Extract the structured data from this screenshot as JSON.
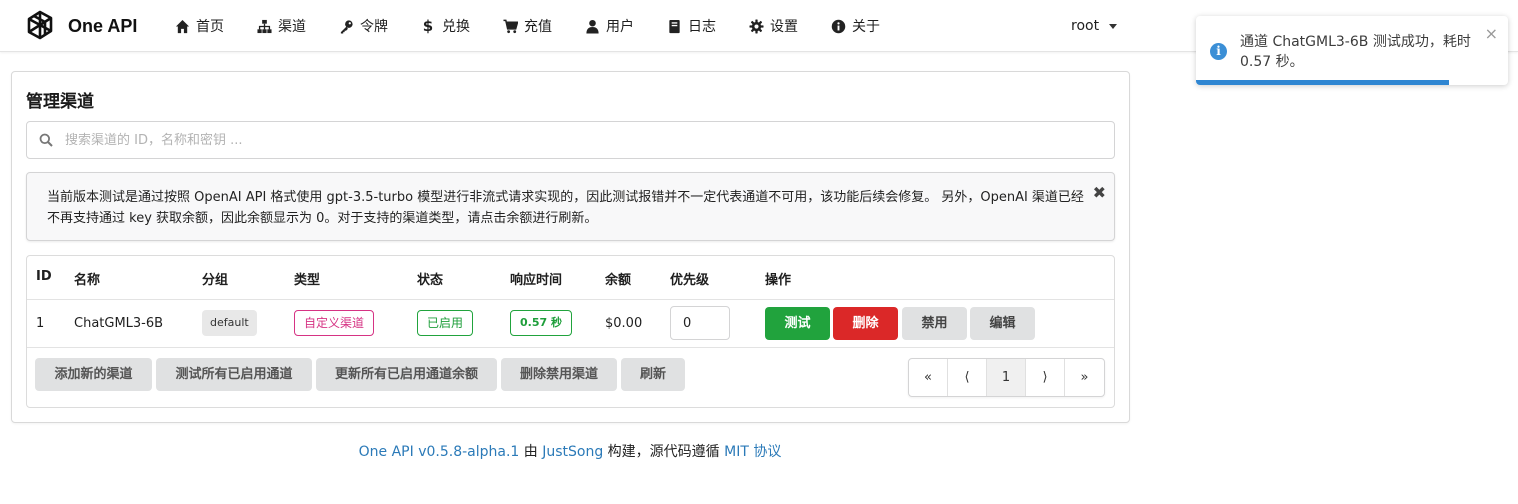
{
  "header": {
    "brand": "One API",
    "nav": [
      {
        "label": "首页",
        "icon": "home-icon"
      },
      {
        "label": "渠道",
        "icon": "sitemap-icon"
      },
      {
        "label": "令牌",
        "icon": "key-icon"
      },
      {
        "label": "兑换",
        "icon": "dollar-icon"
      },
      {
        "label": "充值",
        "icon": "cart-icon"
      },
      {
        "label": "用户",
        "icon": "user-icon"
      },
      {
        "label": "日志",
        "icon": "book-icon"
      },
      {
        "label": "设置",
        "icon": "gear-icon"
      },
      {
        "label": "关于",
        "icon": "info-icon"
      }
    ],
    "user": "root"
  },
  "toast": {
    "message": "通道 ChatGML3-6B 测试成功，耗时 0.57 秒。",
    "progress": 0.81,
    "close": "×",
    "icon_letter": "i"
  },
  "main": {
    "title": "管理渠道",
    "search_placeholder": "搜索渠道的 ID，名称和密钥 ...",
    "notice": "当前版本测试是通过按照 OpenAI API 格式使用 gpt-3.5-turbo 模型进行非流式请求实现的，因此测试报错并不一定代表通道不可用，该功能后续会修复。 另外，OpenAI 渠道已经不再支持通过 key 获取余额，因此余额显示为 0。对于支持的渠道类型，请点击余额进行刷新。",
    "notice_close": "✖"
  },
  "table": {
    "headers": {
      "id": "ID",
      "name": "名称",
      "group": "分组",
      "type": "类型",
      "status": "状态",
      "response": "响应时间",
      "balance": "余额",
      "priority": "优先级",
      "actions": "操作"
    },
    "row": {
      "id": "1",
      "name": "ChatGML3-6B",
      "group": "default",
      "type": "自定义渠道",
      "status": "已启用",
      "response": "0.57 秒",
      "balance": "$0.00",
      "priority": "0",
      "actions": {
        "test": "测试",
        "delete": "删除",
        "disable": "禁用",
        "edit": "编辑"
      }
    }
  },
  "footer_buttons": {
    "add": "添加新的渠道",
    "test_all": "测试所有已启用通道",
    "update_balance": "更新所有已启用通道余额",
    "delete_disabled": "删除禁用渠道",
    "refresh": "刷新"
  },
  "pagination": {
    "first": "«",
    "prev": "⟨",
    "current": "1",
    "next": "⟩",
    "last": "»"
  },
  "footer": {
    "version_link": "One API v0.5.8-alpha.1",
    "by": " 由 ",
    "author_link": "JustSong",
    "build_text": " 构建，源代码遵循 ",
    "license_link": "MIT 协议"
  },
  "colors": {
    "primary_green": "#21a33d",
    "danger_red": "#db2828",
    "link_blue": "#2b7ab8",
    "toast_blue": "#2f86d2"
  }
}
